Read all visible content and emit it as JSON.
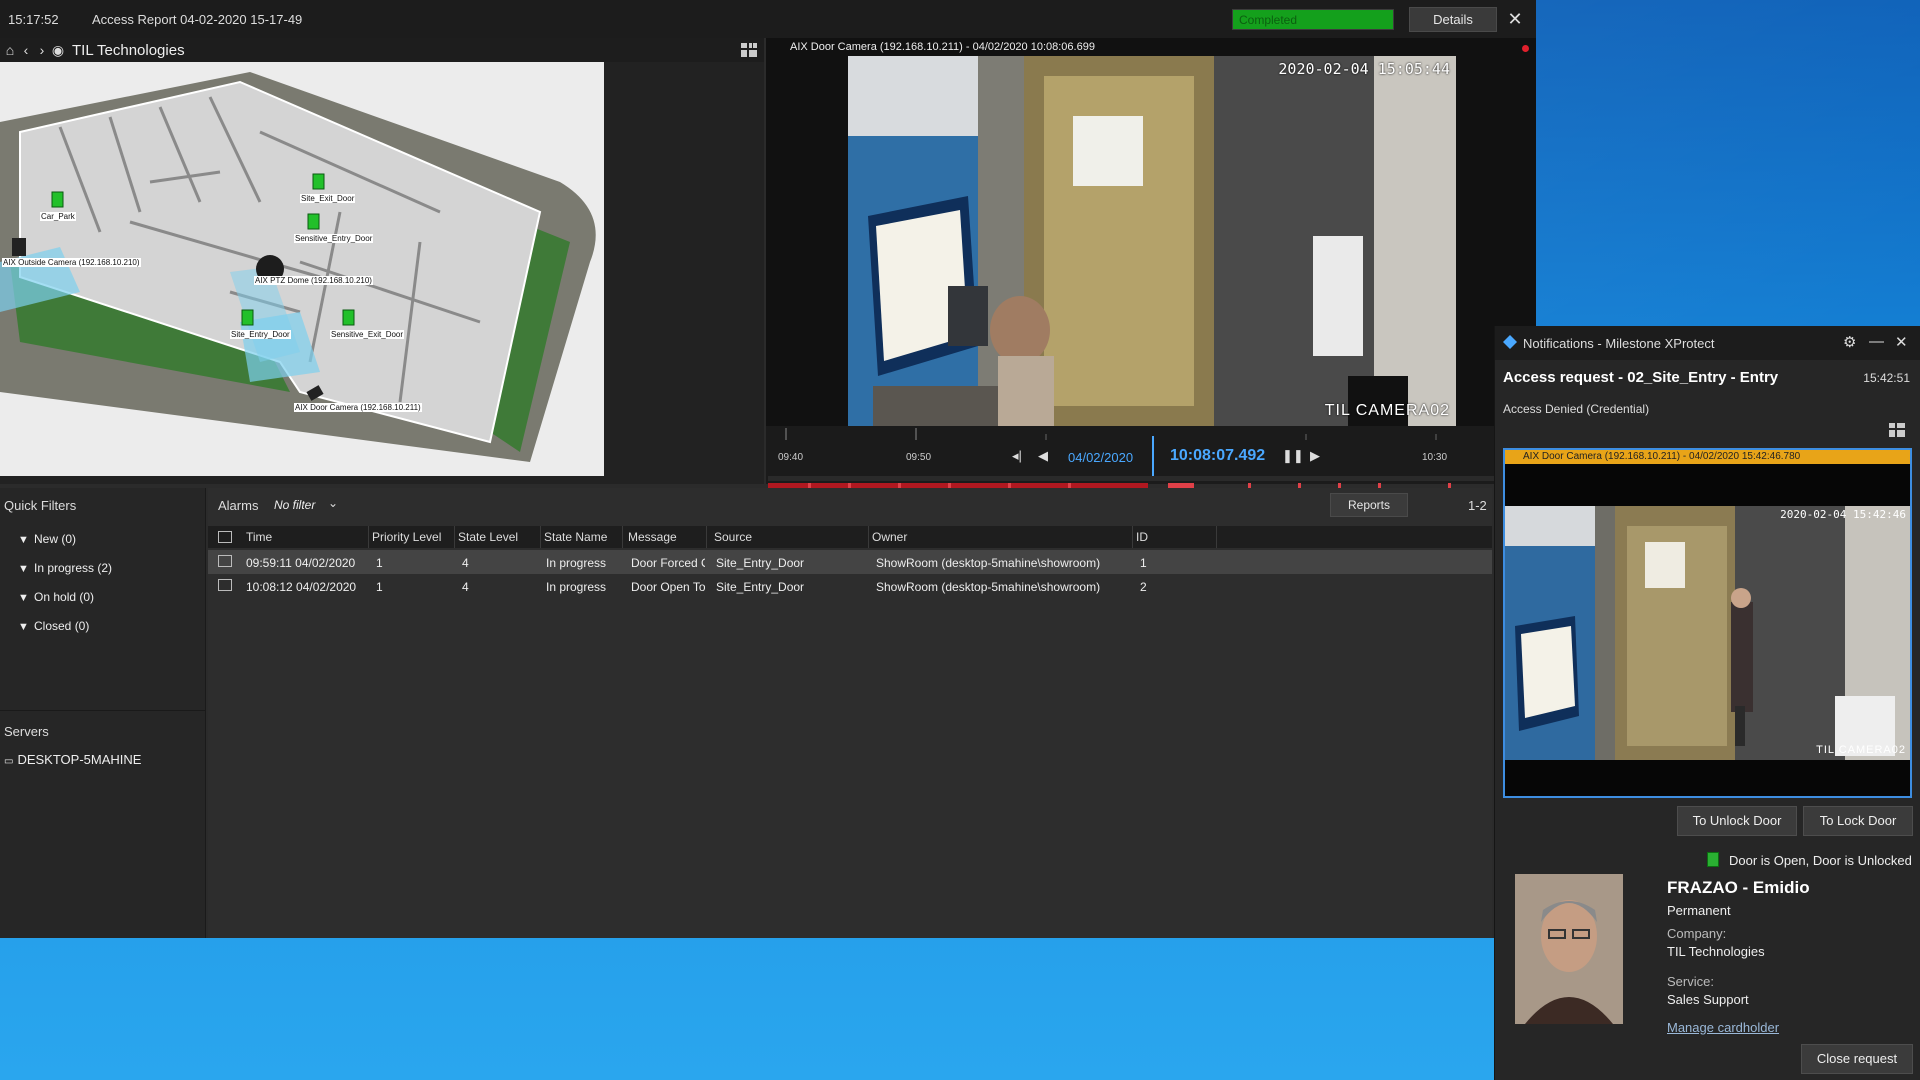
{
  "topbar": {
    "clock": "15:17:52",
    "report_title": "Access Report 04-02-2020 15-17-49",
    "progress_label": "Completed",
    "progress_value": 1.0,
    "details_label": "Details",
    "close_icon": "close-icon"
  },
  "map": {
    "title": "TIL Technologies",
    "labels": {
      "exit_door": "Site_Exit_Door",
      "sensitive_entry": "Sensitive_Entry_Door",
      "outside_camera": "AIX Outside Camera (192.168.10.210)",
      "ptz_dome": "AIX PTZ Dome (192.168.10.210)",
      "site_entry": "Site_Entry_Door",
      "sensitive_exit": "Sensitive_Exit_Door",
      "door_camera": "AIX Door Camera (192.168.10.211)",
      "car_park": "Car_Park"
    }
  },
  "video": {
    "camera_title": "AIX Door Camera (192.168.10.211) - 04/02/2020 10:08:06.699",
    "timestamp": "2020-02-04 15:05:44",
    "camera_name": "TIL CAMERA02",
    "timeline": {
      "t1": "09:40",
      "t2": "09:50",
      "t3": "10:30",
      "date": "04/02/2020",
      "time": "10:08:07.492"
    }
  },
  "quick_filters": {
    "title": "Quick Filters",
    "items": [
      {
        "label": "New (0)"
      },
      {
        "label": "In progress (2)"
      },
      {
        "label": "On hold (0)"
      },
      {
        "label": "Closed (0)"
      }
    ],
    "servers_title": "Servers",
    "server": "DESKTOP-5MAHINE"
  },
  "alarms": {
    "title": "Alarms",
    "filter": "No filter",
    "reports_label": "Reports",
    "page_range": "1-2",
    "columns": [
      "Time",
      "Priority Level",
      "State Level",
      "State Name",
      "Message",
      "Source",
      "Owner",
      "ID"
    ],
    "rows": [
      {
        "time": "09:59:11 04/02/2020",
        "priority": "1",
        "state_level": "4",
        "state_name": "In progress",
        "message": "Door Forced Open",
        "source": "Site_Entry_Door",
        "owner": "ShowRoom (desktop-5mahine\\showroom)",
        "id": "1"
      },
      {
        "time": "10:08:12 04/02/2020",
        "priority": "1",
        "state_level": "4",
        "state_name": "In progress",
        "message": "Door Open Too Long",
        "source": "Site_Entry_Door",
        "owner": "ShowRoom (desktop-5mahine\\showroom)",
        "id": "2"
      }
    ]
  },
  "notification": {
    "title": "Notifications - Milestone XProtect",
    "request_title": "Access request - 02_Site_Entry - Entry",
    "request_time": "15:42:51",
    "status": "Access Denied (Credential)",
    "video_title": "AIX Door Camera (192.168.10.211) - 04/02/2020 15:42:46.780",
    "video_timestamp": "2020-02-04 15:42:46",
    "video_camera_name": "TIL CAMERA02",
    "unlock_label": "To Unlock Door",
    "lock_label": "To Lock Door",
    "door_status": "Door is Open, Door is Unlocked",
    "cardholder": {
      "name": "FRAZAO - Emidio",
      "type": "Permanent",
      "company_label": "Company:",
      "company": "TIL Technologies",
      "service_label": "Service:",
      "service": "Sales Support",
      "manage_label": "Manage cardholder"
    },
    "close_request_label": "Close request"
  },
  "colors": {
    "accent": "#4aa8ff",
    "progress": "#14a01c",
    "video_title_bar": "#e8a418",
    "selection_border": "#3d8de0"
  }
}
